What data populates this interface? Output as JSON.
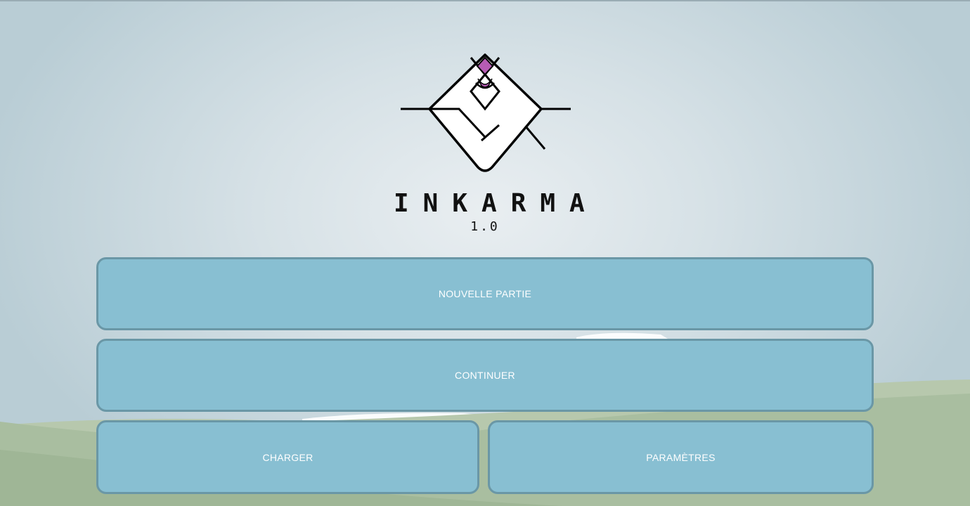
{
  "game": {
    "title": "INKARMA",
    "version": "1.0"
  },
  "menu": {
    "new_game": "NOUVELLE PARTIE",
    "continue": "CONTINUER",
    "load": "CHARGER",
    "settings": "PARAMÈTRES"
  },
  "colors": {
    "button_fill": "#88bfd2",
    "button_border": "#6a97a6",
    "logo_accent": "#b65cb4",
    "hills": "#a9bea0"
  }
}
